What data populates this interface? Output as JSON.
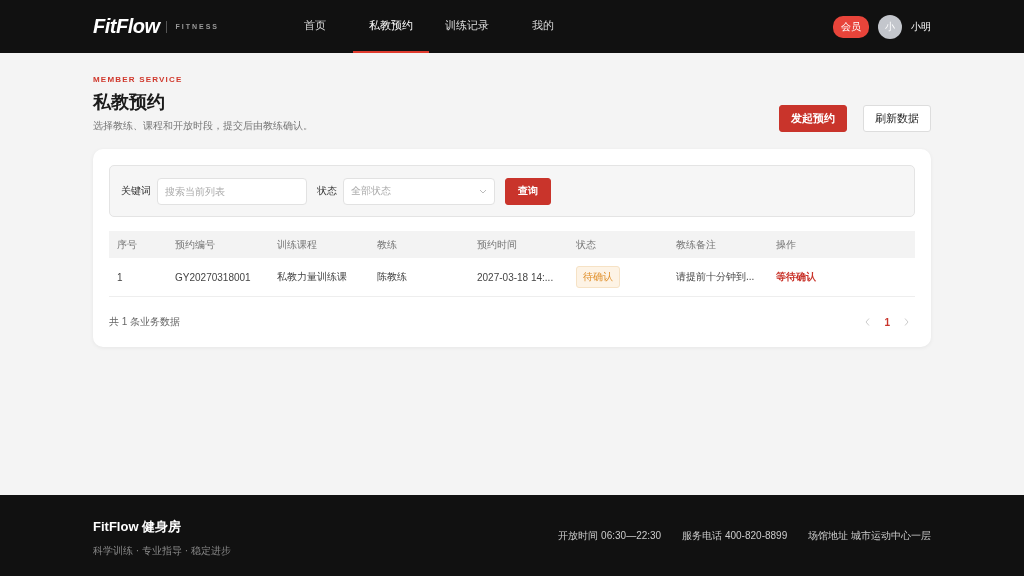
{
  "header": {
    "logo": "FitFlow",
    "logo_tagline": "FITNESS",
    "nav": [
      {
        "label": "首页",
        "selected": false
      },
      {
        "label": "私教预约",
        "selected": true
      },
      {
        "label": "训练记录",
        "selected": false
      },
      {
        "label": "我的",
        "selected": false
      }
    ],
    "member_badge": "会员",
    "avatar_initial": "小",
    "username": "小明"
  },
  "page": {
    "eyebrow": "MEMBER SERVICE",
    "title": "私教预约",
    "subtitle": "选择教练、课程和开放时段，提交后由教练确认。",
    "actions": [
      {
        "label": "发起预约",
        "kind": "primary"
      },
      {
        "label": "刷新数据",
        "kind": "secondary"
      }
    ]
  },
  "filters": {
    "keyword_label": "关键词",
    "keyword_placeholder": "搜索当前列表",
    "status_label": "状态",
    "status_placeholder": "全部状态",
    "query_button": "查询"
  },
  "table": {
    "columns": [
      "序号",
      "预约编号",
      "训练课程",
      "教练",
      "预约时间",
      "状态",
      "教练备注",
      "操作"
    ],
    "rows": [
      {
        "cells": [
          {
            "text": "1",
            "kind": "text"
          },
          {
            "text": "GY20270318001",
            "kind": "text"
          },
          {
            "text": "私教力量训练课",
            "kind": "text"
          },
          {
            "text": "陈教练",
            "kind": "text"
          },
          {
            "text": "2027-03-18 14:...",
            "kind": "text"
          },
          {
            "text": "待确认",
            "kind": "badge"
          },
          {
            "text": "请提前十分钟到...",
            "kind": "text"
          },
          {
            "text": "等待确认",
            "kind": "link"
          }
        ]
      }
    ]
  },
  "pagination": {
    "summary": "共 1 条业务数据",
    "pages": [
      {
        "label": "1",
        "selected": true
      }
    ]
  },
  "footer": {
    "brand": "FitFlow 健身房",
    "tagline": "科学训练 · 专业指导 · 稳定进步",
    "info": [
      "开放时间 06:30—22:30",
      "服务电话 400-820-8899",
      "场馆地址 城市运动中心一层"
    ]
  }
}
